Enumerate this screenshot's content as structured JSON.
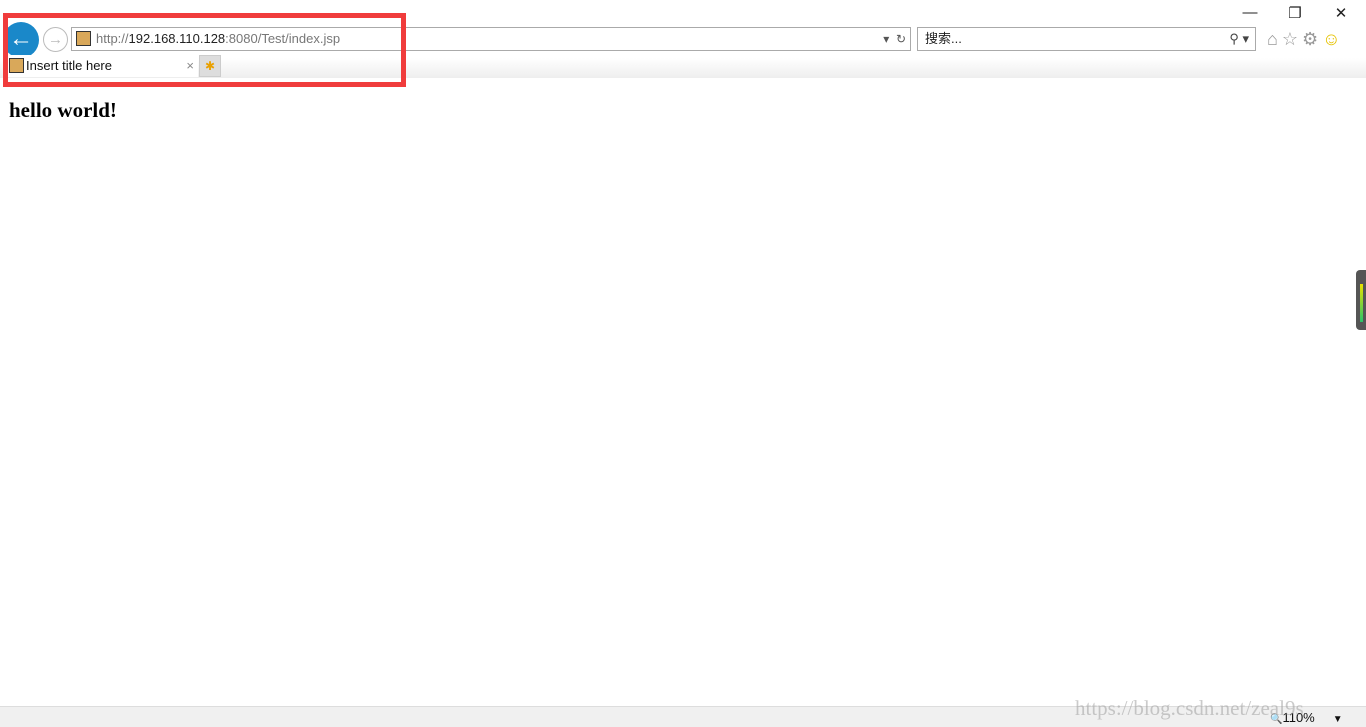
{
  "window": {
    "minimize": "—",
    "restore": "❐",
    "close": "✕"
  },
  "nav": {
    "back_icon": "arrow-left",
    "forward_icon": "arrow-right"
  },
  "address": {
    "scheme": "http://",
    "host": "192.168.110.128",
    "rest": ":8080/Test/index.jsp",
    "dropdown": "▾",
    "refresh": "↻"
  },
  "search": {
    "placeholder": "搜索...",
    "search_icon": "⚲",
    "dropdown": "▾"
  },
  "tools": {
    "home": "⌂",
    "favorites": "☆",
    "settings": "⚙",
    "feedback": "☺"
  },
  "tab": {
    "title": "Insert title here",
    "close": "×",
    "new_tab": "✱"
  },
  "page": {
    "heading": "hello world!"
  },
  "status": {
    "zoom_icon": "🔍",
    "zoom": "110%",
    "zoom_dropdown": "▼"
  },
  "watermark": "https://blog.csdn.net/zeal9s",
  "colors": {
    "highlight_box": "#f03c3c",
    "back_button": "#1a88c9"
  }
}
